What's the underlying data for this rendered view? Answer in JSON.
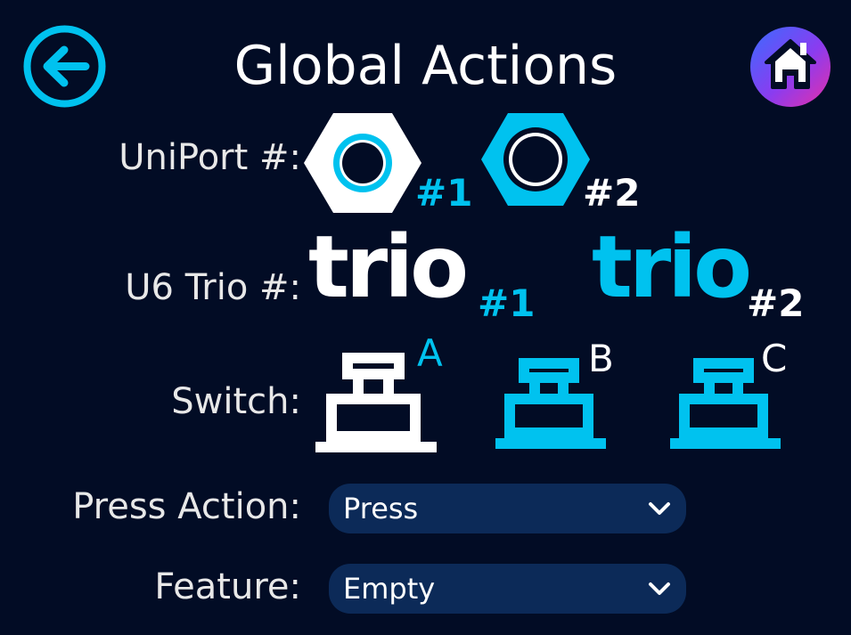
{
  "header": {
    "title": "Global Actions",
    "back_icon": "back-arrow-icon",
    "home_icon": "home-icon"
  },
  "uniport": {
    "label": "UniPort #:",
    "items": [
      {
        "num": "#1",
        "selected": true
      },
      {
        "num": "#2",
        "selected": false
      }
    ]
  },
  "trio": {
    "label": "U6 Trio #:",
    "items": [
      {
        "text": "trio",
        "num": "#1",
        "selected": true
      },
      {
        "text": "trio",
        "num": "#2",
        "selected": false
      }
    ]
  },
  "switch": {
    "label": "Switch:",
    "items": [
      {
        "letter": "A",
        "selected": true
      },
      {
        "letter": "B",
        "selected": false
      },
      {
        "letter": "C",
        "selected": false
      }
    ]
  },
  "press_action": {
    "label": "Press Action:",
    "value": "Press"
  },
  "feature": {
    "label": "Feature:",
    "value": "Empty"
  },
  "colors": {
    "background": "#020c25",
    "accent": "#00c2ef",
    "selected": "#ffffff",
    "dropdown": "#0c2a58"
  }
}
